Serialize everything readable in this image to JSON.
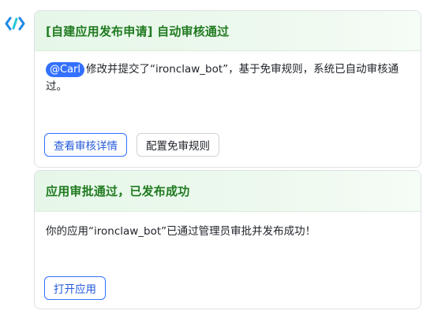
{
  "card1": {
    "title": "[自建应用发布申请] 自动审核通过",
    "mention": "@Carl",
    "message": "修改并提交了“ironclaw_bot”，基于免审规则，系统已自动审核通过。",
    "buttons": {
      "view_details": "查看审核详情",
      "configure_rules": "配置免审规则"
    }
  },
  "card2": {
    "title": "应用审批通过，已发布成功",
    "message": "你的应用“ironclaw_bot”已通过管理员审批并发布成功！",
    "buttons": {
      "open_app": "打开应用"
    }
  },
  "colors": {
    "accent": "#3370ff",
    "title_green": "#1f7a1f",
    "header_bg": "#e6f7e9"
  }
}
